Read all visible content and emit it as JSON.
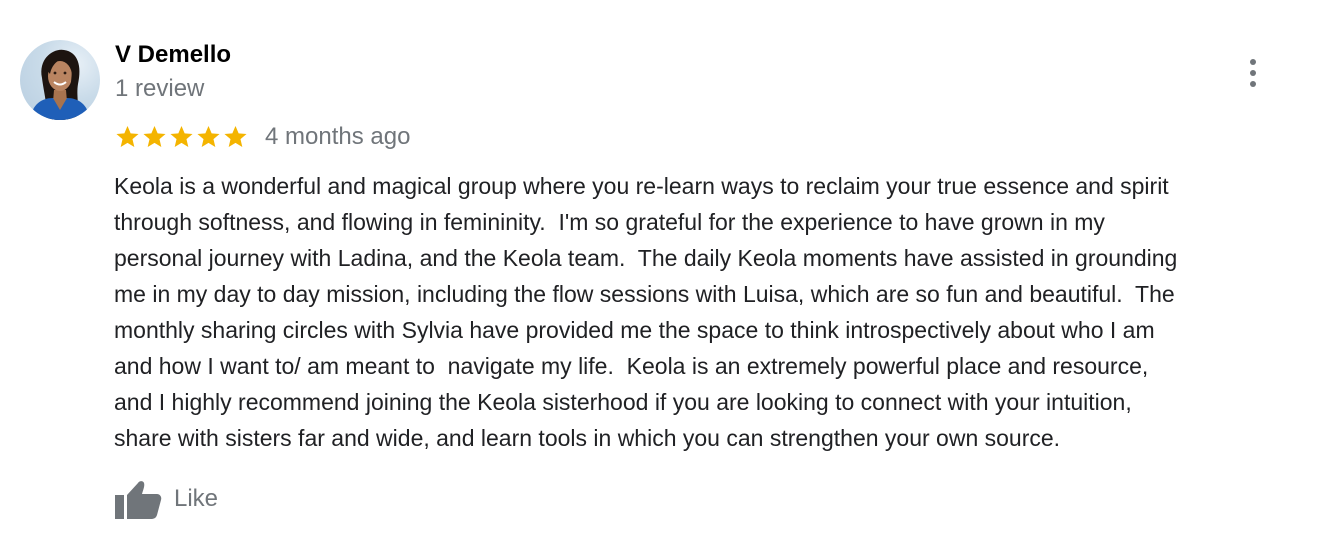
{
  "review": {
    "author": {
      "name": "V Demello",
      "review_count": "1 review"
    },
    "rating": {
      "stars": 5,
      "max_stars": 5,
      "star_color": "#f4b400"
    },
    "time_ago": "4 months ago",
    "text_lines": [
      "Keola is a wonderful and magical group where you re-learn ways to reclaim your true essence and spirit",
      "through softness, and flowing in femininity.  I'm so grateful for the experience to have grown in my",
      "personal journey with Ladina, and the Keola team.  The daily Keola moments have assisted in grounding",
      "me in my day to day mission, including the flow sessions with Luisa, which are so fun and beautiful.  The",
      "monthly sharing circles with Sylvia have provided me the space to think introspectively about who I am",
      "and how I want to/ am meant to  navigate my life.  Keola is an extremely powerful place and resource,",
      "and I highly recommend joining the Keola sisterhood if you are looking to connect with your intuition,",
      "share with sisters far and wide, and learn tools in which you can strengthen your own source."
    ],
    "like": {
      "label": "Like",
      "icon": "thumbs-up-icon"
    },
    "more_icon": "more-vert-icon"
  },
  "colors": {
    "name": "#000000",
    "secondary_text": "#70757a",
    "body_text": "#202124",
    "star": "#f4b400"
  }
}
